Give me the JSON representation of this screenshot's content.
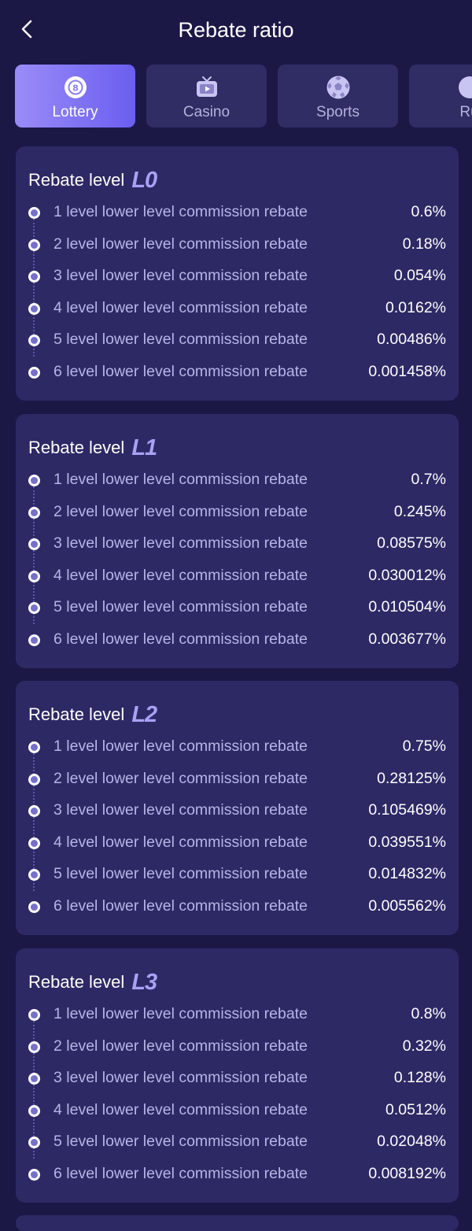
{
  "header": {
    "title": "Rebate ratio"
  },
  "tabs": [
    {
      "label": "Lottery",
      "icon": "lottery-ball-icon",
      "active": true
    },
    {
      "label": "Casino",
      "icon": "tv-icon",
      "active": false
    },
    {
      "label": "Sports",
      "icon": "soccer-ball-icon",
      "active": false
    },
    {
      "label": "Ru",
      "icon": "game-icon",
      "active": false
    }
  ],
  "cards": [
    {
      "title": "Rebate level",
      "level": "L0",
      "rows": [
        {
          "label": "1 level lower level commission rebate",
          "value": "0.6%"
        },
        {
          "label": "2 level lower level commission rebate",
          "value": "0.18%"
        },
        {
          "label": "3 level lower level commission rebate",
          "value": "0.054%"
        },
        {
          "label": "4 level lower level commission rebate",
          "value": "0.0162%"
        },
        {
          "label": "5 level lower level commission rebate",
          "value": "0.00486%"
        },
        {
          "label": "6 level lower level commission rebate",
          "value": "0.001458%"
        }
      ]
    },
    {
      "title": "Rebate level",
      "level": "L1",
      "rows": [
        {
          "label": "1 level lower level commission rebate",
          "value": "0.7%"
        },
        {
          "label": "2 level lower level commission rebate",
          "value": "0.245%"
        },
        {
          "label": "3 level lower level commission rebate",
          "value": "0.08575%"
        },
        {
          "label": "4 level lower level commission rebate",
          "value": "0.030012%"
        },
        {
          "label": "5 level lower level commission rebate",
          "value": "0.010504%"
        },
        {
          "label": "6 level lower level commission rebate",
          "value": "0.003677%"
        }
      ]
    },
    {
      "title": "Rebate level",
      "level": "L2",
      "rows": [
        {
          "label": "1 level lower level commission rebate",
          "value": "0.75%"
        },
        {
          "label": "2 level lower level commission rebate",
          "value": "0.28125%"
        },
        {
          "label": "3 level lower level commission rebate",
          "value": "0.105469%"
        },
        {
          "label": "4 level lower level commission rebate",
          "value": "0.039551%"
        },
        {
          "label": "5 level lower level commission rebate",
          "value": "0.014832%"
        },
        {
          "label": "6 level lower level commission rebate",
          "value": "0.005562%"
        }
      ]
    },
    {
      "title": "Rebate level",
      "level": "L3",
      "rows": [
        {
          "label": "1 level lower level commission rebate",
          "value": "0.8%"
        },
        {
          "label": "2 level lower level commission rebate",
          "value": "0.32%"
        },
        {
          "label": "3 level lower level commission rebate",
          "value": "0.128%"
        },
        {
          "label": "4 level lower level commission rebate",
          "value": "0.0512%"
        },
        {
          "label": "5 level lower level commission rebate",
          "value": "0.02048%"
        },
        {
          "label": "6 level lower level commission rebate",
          "value": "0.008192%"
        }
      ]
    }
  ],
  "colors": {
    "background": "#1b1846",
    "card": "#2d2965",
    "tab": "#302c64",
    "accent": "#6a5ef0",
    "level_badge": "#a9a1f6"
  }
}
